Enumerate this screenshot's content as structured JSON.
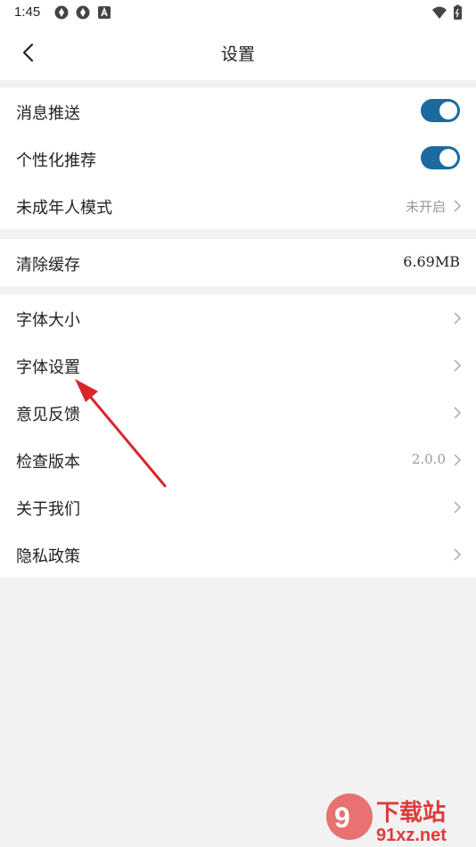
{
  "status_bar": {
    "time": "1:45",
    "left_icons": [
      "sync-icon",
      "sync-icon",
      "app-notification-icon"
    ],
    "right_icons": [
      "wifi-icon",
      "battery-icon"
    ]
  },
  "header": {
    "title": "设置",
    "back_icon": "chevron-left-icon"
  },
  "group1": [
    {
      "label": "消息推送",
      "control": "toggle",
      "on": true
    },
    {
      "label": "个性化推荐",
      "control": "toggle",
      "on": true
    },
    {
      "label": "未成年人模式",
      "value": "未开启",
      "control": "chevron"
    }
  ],
  "group2": [
    {
      "label": "清除缓存",
      "value": "6.69MB"
    }
  ],
  "group3": [
    {
      "label": "字体大小"
    },
    {
      "label": "字体设置"
    },
    {
      "label": "意见反馈"
    },
    {
      "label": "检查版本",
      "value": "2.0.0"
    },
    {
      "label": "关于我们"
    },
    {
      "label": "隐私政策"
    }
  ],
  "annotation": {
    "color": "#d9252a"
  },
  "colors": {
    "toggle_on": "#1b6aa0",
    "background": "#f2f2f2"
  },
  "watermark": {
    "text1": "下载站",
    "text2": "91xz.net"
  }
}
